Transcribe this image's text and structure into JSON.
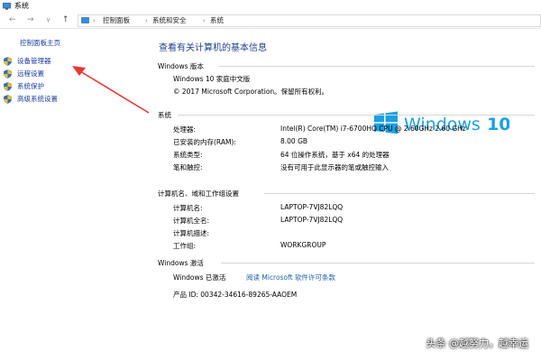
{
  "window": {
    "title": "系统"
  },
  "nav": {
    "back": "←",
    "forward": "→",
    "recent": "∨",
    "up": "↑",
    "breadcrumbs": [
      "控制面板",
      "系统和安全",
      "系统"
    ]
  },
  "sidebar": {
    "home": "控制面板主页",
    "items": [
      {
        "label": "设备管理器"
      },
      {
        "label": "远程设置"
      },
      {
        "label": "系统保护"
      },
      {
        "label": "高级系统设置"
      }
    ]
  },
  "main": {
    "title": "查看有关计算机的基本信息",
    "edition": {
      "header": "Windows 版本",
      "name": "Windows 10 家庭中文版",
      "copyright": "© 2017 Microsoft Corporation。保留所有权利。"
    },
    "system": {
      "header": "系统",
      "rows": [
        {
          "label": "处理器:",
          "value": "Intel(R) Core(TM) i7-6700HQ CPU @ 2.60GHz   2.60 GHz"
        },
        {
          "label": "已安装的内存(RAM):",
          "value": "8.00 GB"
        },
        {
          "label": "系统类型:",
          "value": "64 位操作系统，基于 x64 的处理器"
        },
        {
          "label": "笔和触控:",
          "value": "没有可用于此显示器的笔或触控输入"
        }
      ]
    },
    "computer": {
      "header": "计算机名、域和工作组设置",
      "rows": [
        {
          "label": "计算机名:",
          "value": "LAPTOP-7VJ82LQQ"
        },
        {
          "label": "计算机全名:",
          "value": "LAPTOP-7VJ82LQQ"
        },
        {
          "label": "计算机描述:",
          "value": ""
        },
        {
          "label": "工作组:",
          "value": "WORKGROUP"
        }
      ]
    },
    "activation": {
      "header": "Windows 激活",
      "status": "Windows 已激活",
      "license_link": "阅读 Microsoft 软件许可条款",
      "product_id": "产品 ID: 00342-34616-89265-AAOEM"
    }
  },
  "watermark": "头条 @越努力，越幸运",
  "colors": {
    "link": "#1a5fb4",
    "title": "#1e3f8a",
    "arrow": "#e53935",
    "logo": "#1ba1e2"
  }
}
